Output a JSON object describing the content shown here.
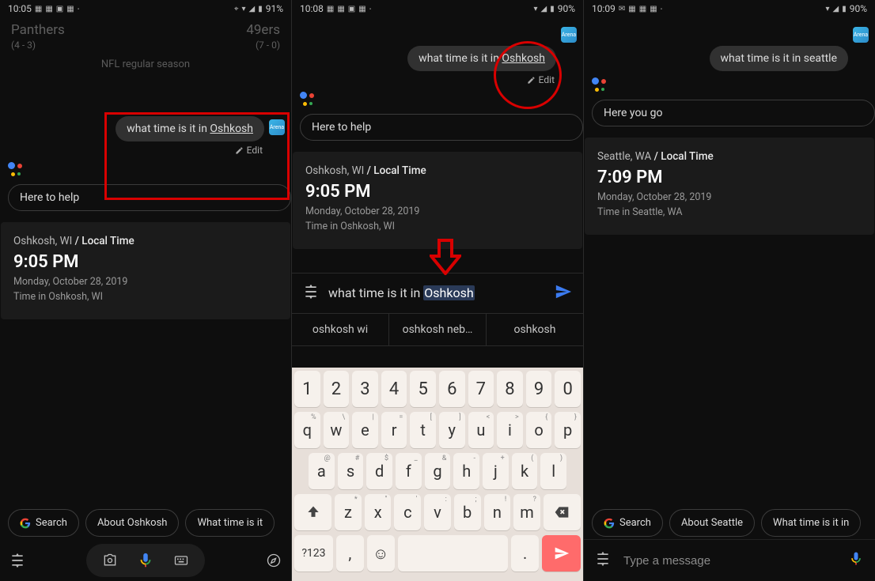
{
  "phones": [
    {
      "status": {
        "time": "10:05",
        "batt": "91%"
      },
      "score": {
        "team_l": "Panthers",
        "rec_l": "(4 - 3)",
        "team_r": "49ers",
        "rec_r": "(7 - 0)",
        "league": "NFL regular season"
      },
      "user_query_prefix": "what time is it in ",
      "user_query_place": "Oshkosh",
      "edit_label": "Edit",
      "asst_reply": "Here to help",
      "card": {
        "city": "Oshkosh, WI",
        "local": " / Local Time",
        "time": "9:05 PM",
        "date": "Monday, October 28, 2019",
        "tz": "Time in Oshkosh, WI"
      },
      "chips": [
        "Search",
        "About Oshkosh",
        "What time is it"
      ]
    },
    {
      "status": {
        "time": "10:08",
        "batt": "90%"
      },
      "user_query_prefix": "what time is it in ",
      "user_query_place": "Oshkosh",
      "edit_label": "Edit",
      "asst_reply": "Here to help",
      "card": {
        "city": "Oshkosh, WI",
        "local": " / Local Time",
        "time": "9:05 PM",
        "date": "Monday, October 28, 2019",
        "tz": "Time in Oshkosh, WI"
      },
      "edit_prefix": "what time is it in ",
      "edit_sel": "Oshkosh",
      "suggestions": [
        "oshkosh wi",
        "oshkosh neb…",
        "oshkosh"
      ]
    },
    {
      "status": {
        "time": "10:09",
        "batt": "90%"
      },
      "user_query": "what time is it in seattle",
      "asst_reply": "Here you go",
      "card": {
        "city": "Seattle, WA",
        "local": " / Local Time",
        "time": "7:09 PM",
        "date": "Monday, October 28, 2019",
        "tz": "Time in Seattle, WA"
      },
      "chips": [
        "Search",
        "About Seattle",
        "What time is it in"
      ],
      "input_placeholder": "Type a message"
    }
  ],
  "keyboard": {
    "row1": [
      "1",
      "2",
      "3",
      "4",
      "5",
      "6",
      "7",
      "8",
      "9",
      "0"
    ],
    "row2": [
      "q",
      "w",
      "e",
      "r",
      "t",
      "y",
      "u",
      "i",
      "o",
      "p"
    ],
    "row2_sup": [
      "%",
      "\\",
      "|",
      "=",
      "[",
      "]",
      "<",
      ">",
      "{",
      "}"
    ],
    "row3": [
      "a",
      "s",
      "d",
      "f",
      "g",
      "h",
      "j",
      "k",
      "l"
    ],
    "row3_sup": [
      "@",
      "#",
      "$",
      "_",
      "&",
      "-",
      "+",
      "(",
      ")"
    ],
    "row4": [
      "z",
      "x",
      "c",
      "v",
      "b",
      "n",
      "m"
    ],
    "row4_sup": [
      "*",
      "\"",
      "'",
      ":",
      ";",
      "!",
      "?"
    ],
    "sym": "?123",
    "comma": ",",
    "period": "."
  }
}
